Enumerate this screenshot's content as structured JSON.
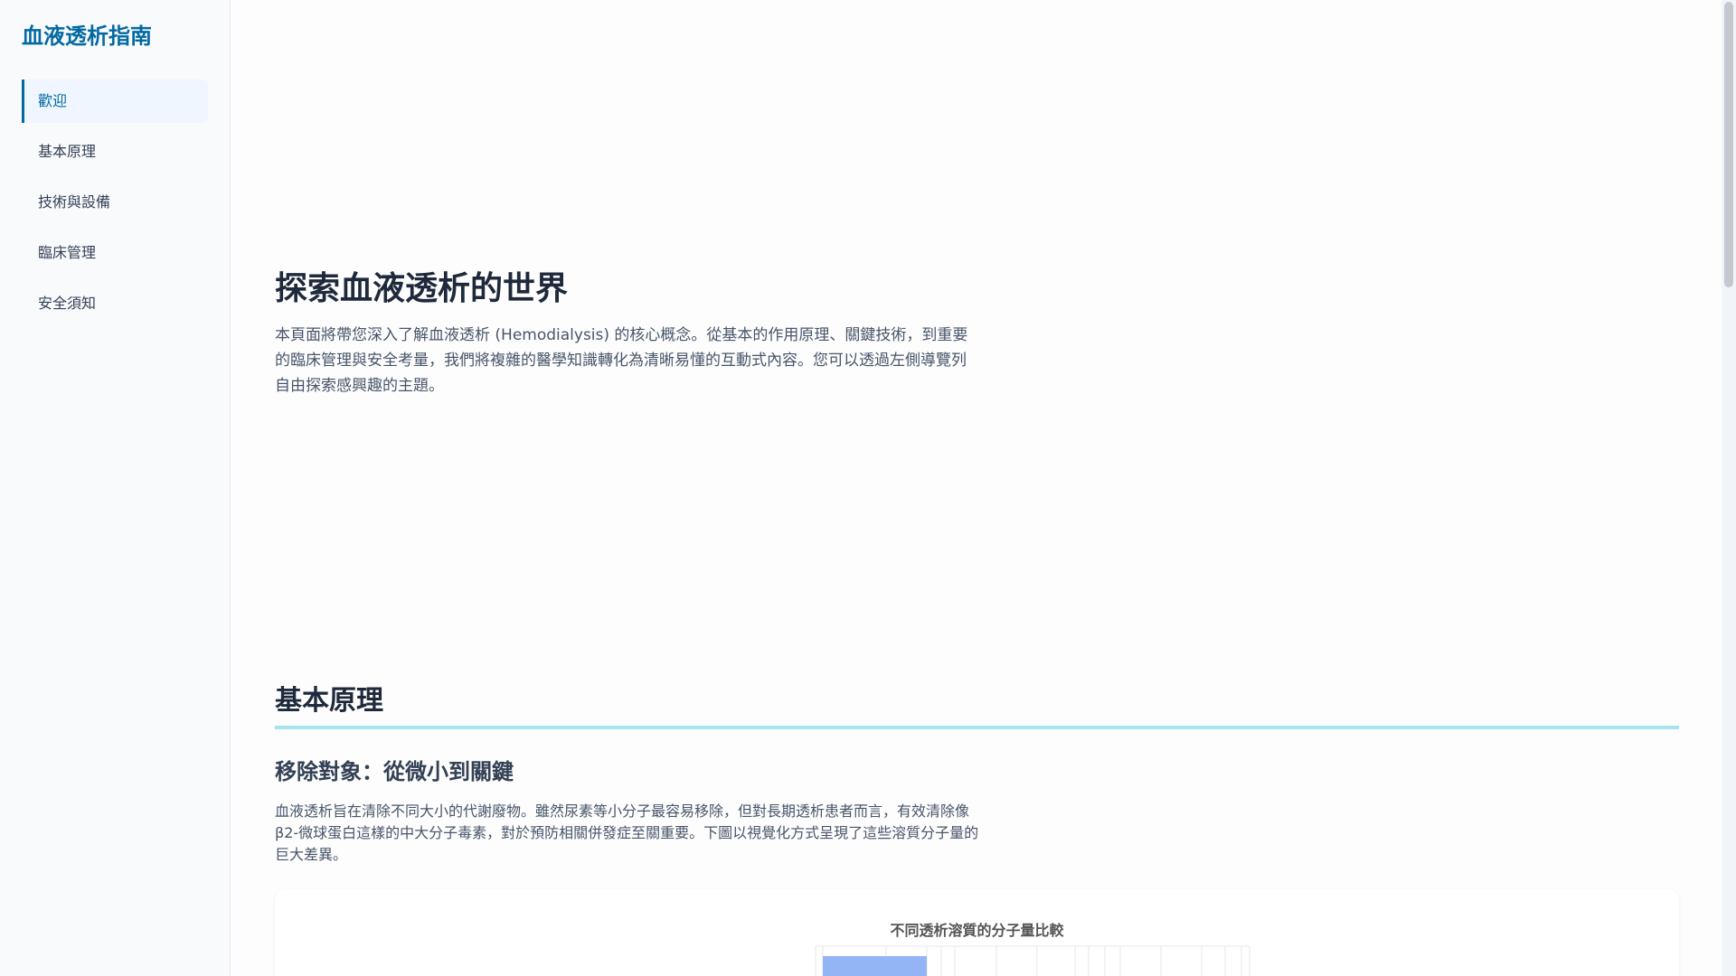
{
  "sidebar": {
    "brand": "血液透析指南",
    "items": [
      {
        "label": "歡迎",
        "active": true
      },
      {
        "label": "基本原理",
        "active": false
      },
      {
        "label": "技術與設備",
        "active": false
      },
      {
        "label": "臨床管理",
        "active": false
      },
      {
        "label": "安全須知",
        "active": false
      }
    ]
  },
  "hero": {
    "title": "探索血液透析的世界",
    "text": "本頁面將帶您深入了解血液透析 (Hemodialysis) 的核心概念。從基本的作用原理、關鍵技術，到重要的臨床管理與安全考量，我們將複雜的醫學知識轉化為清晰易懂的互動式內容。您可以透過左側導覽列自由探索感興趣的主題。"
  },
  "section": {
    "title": "基本原理",
    "subsection_title": "移除對象：從微小到關鍵",
    "subsection_text": "血液透析旨在清除不同大小的代謝廢物。雖然尿素等小分子最容易移除，但對長期透析患者而言，有效清除像β2-微球蛋白這樣的中大分子毒素，對於預防相關併發症至關重要。下圖以視覺化方式呈現了這些溶質分子量的巨大差異。"
  },
  "chart_data": {
    "type": "bar",
    "title": "不同透析溶質的分子量比較",
    "colors": {
      "bar": "#93b4f5",
      "grid": "#e5e7eb"
    }
  },
  "colors": {
    "accent": "#0369a1",
    "section_rule": "#a5e3f0"
  }
}
